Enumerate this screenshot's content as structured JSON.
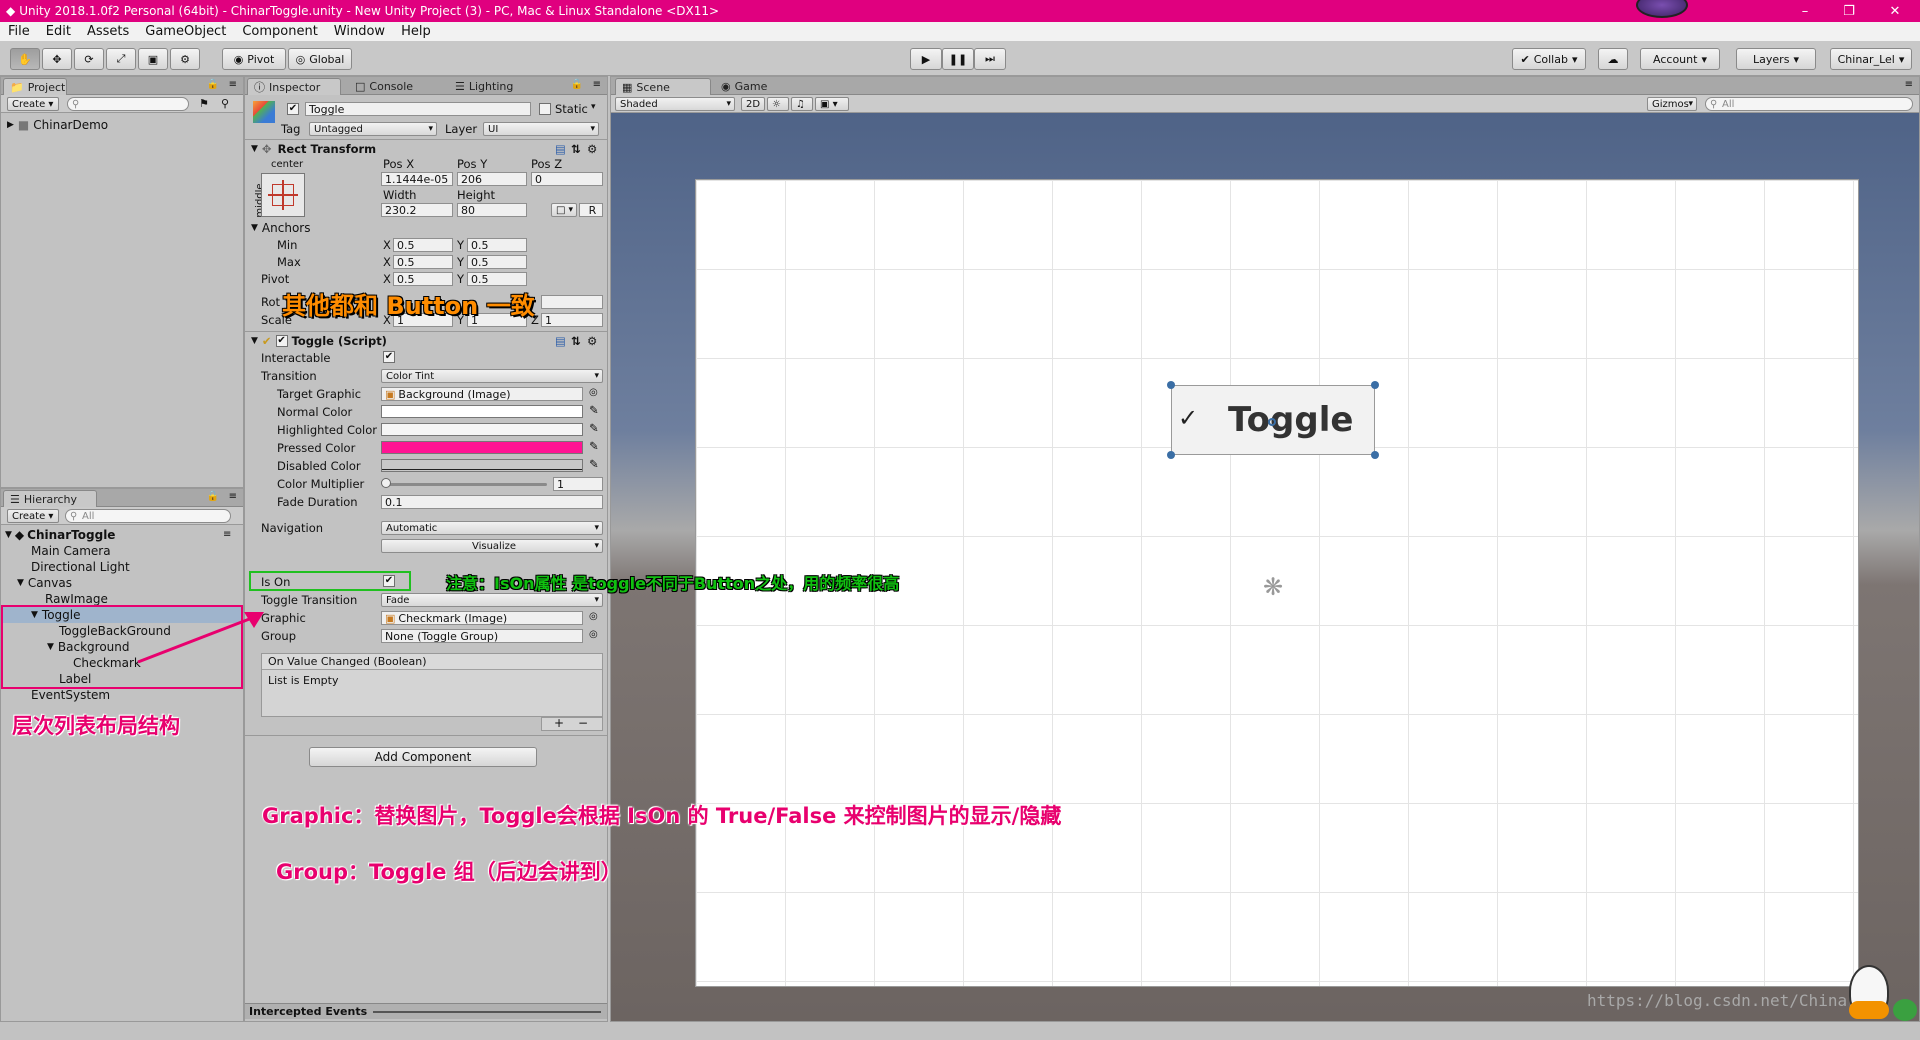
{
  "titlebar": {
    "title": "Unity 2018.1.0f2 Personal (64bit) - ChinarToggle.unity - New Unity Project (3) - PC, Mac & Linux Standalone <DX11>"
  },
  "menu": [
    "File",
    "Edit",
    "Assets",
    "GameObject",
    "Component",
    "Window",
    "Help"
  ],
  "toolbar": {
    "pivot": "Pivot",
    "global": "Global",
    "collab": "Collab",
    "account": "Account",
    "layers": "Layers",
    "layout": "Chinar_Lel"
  },
  "project": {
    "tab": "Project",
    "create": "Create",
    "folder": "ChinarDemo"
  },
  "hierarchy": {
    "tab": "Hierarchy",
    "create": "Create",
    "search_placeholder": "All",
    "scene": "ChinarToggle",
    "items": [
      "Main Camera",
      "Directional Light",
      "Canvas",
      "RawImage",
      "Toggle",
      "ToggleBackGround",
      "Background",
      "Checkmark",
      "Label",
      "EventSystem"
    ]
  },
  "inspector": {
    "tabs": [
      "Inspector",
      "Console",
      "Lighting"
    ],
    "object_name": "Toggle",
    "static_label": "Static",
    "tag_label": "Tag",
    "tag_value": "Untagged",
    "layer_label": "Layer",
    "layer_value": "UI",
    "rect": {
      "title": "Rect Transform",
      "anchor_h": "center",
      "anchor_v": "middle",
      "posx_label": "Pos X",
      "posy_label": "Pos Y",
      "posz_label": "Pos Z",
      "posx": "1.1444e-05",
      "posy": "206",
      "posz": "0",
      "width_label": "Width",
      "height_label": "Height",
      "width": "230.2",
      "height": "80",
      "r_button": "R",
      "anchors": "Anchors",
      "min": "Min",
      "max": "Max",
      "min_x": "0.5",
      "min_y": "0.5",
      "max_x": "0.5",
      "max_y": "0.5",
      "pivot": "Pivot",
      "pivot_x": "0.5",
      "pivot_y": "0.5",
      "rotation": "Rot",
      "scale": "Scale",
      "scale_x": "1",
      "scale_y": "1",
      "scale_z": "1",
      "x": "X",
      "y": "Y",
      "z": "Z"
    },
    "toggle": {
      "title": "Toggle (Script)",
      "interactable": "Interactable",
      "transition": "Transition",
      "transition_value": "Color Tint",
      "target_graphic": "Target Graphic",
      "target_graphic_value": "Background (Image)",
      "normal_color": "Normal Color",
      "highlighted_color": "Highlighted Color",
      "pressed_color": "Pressed Color",
      "disabled_color": "Disabled Color",
      "color_multiplier": "Color Multiplier",
      "color_multiplier_value": "1",
      "fade_duration": "Fade Duration",
      "fade_duration_value": "0.1",
      "navigation": "Navigation",
      "navigation_value": "Automatic",
      "visualize": "Visualize",
      "is_on": "Is On",
      "toggle_transition": "Toggle Transition",
      "toggle_transition_value": "Fade",
      "graphic": "Graphic",
      "graphic_value": "Checkmark (Image)",
      "group": "Group",
      "group_value": "None (Toggle Group)",
      "event": "On Value Changed (Boolean)",
      "list_empty": "List is Empty",
      "plus": "+",
      "minus": "−"
    },
    "add_component": "Add Component",
    "intercepted": "Intercepted Events"
  },
  "scene": {
    "tabs": [
      "Scene",
      "Game"
    ],
    "shading": "Shaded",
    "mode2d": "2D",
    "gizmos": "Gizmos",
    "search_placeholder": "All",
    "toggle_label": "Toggle",
    "watermark": "https://blog.csdn.net/Chinar"
  },
  "colors": {
    "titlebar": "#e0007f",
    "normal": "#ffffff",
    "highlighted": "#f5f5f5",
    "pressed": "#ff1493",
    "disabled": "#c8c8c8",
    "annotation_pink": "#e8006e",
    "annotation_orange": "#ff8c00",
    "annotation_green": "#10c010"
  },
  "annotations": {
    "same_as_button": "其他都和 Button 一致",
    "ison_note": "注意：IsOn属性 是toggle不同于Button之处，用的频率很高",
    "hierarchy_note": "层次列表布局结构",
    "graphic_note": "Graphic：替换图片，Toggle会根据 IsOn 的 True/False 来控制图片的显示/隐藏",
    "group_note": "Group：Toggle 组（后边会讲到）"
  }
}
